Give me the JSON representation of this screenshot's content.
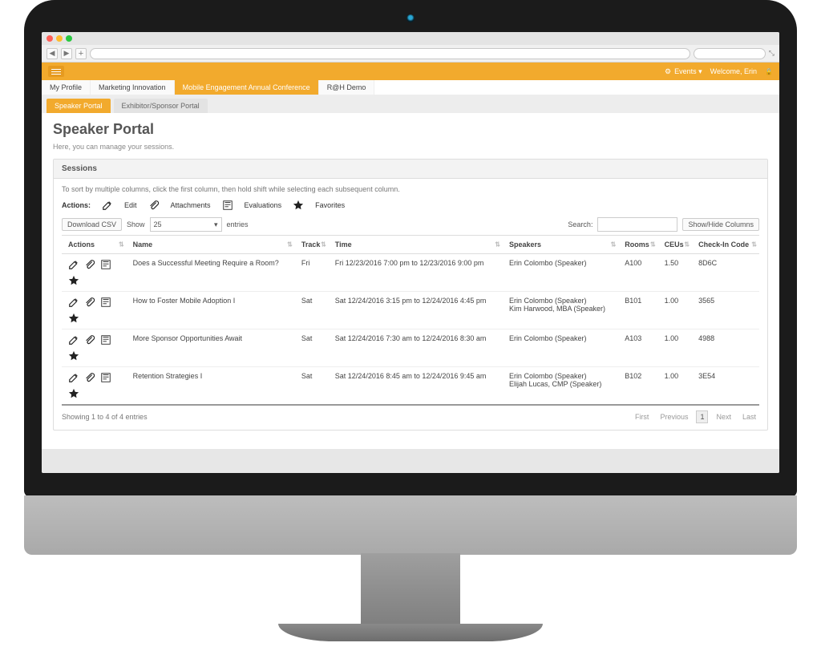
{
  "header": {
    "events_label": "Events",
    "welcome_label": "Welcome, Erin"
  },
  "top_tabs": [
    {
      "label": "My Profile",
      "active": false
    },
    {
      "label": "Marketing Innovation",
      "active": false
    },
    {
      "label": "Mobile Engagement Annual Conference",
      "active": true
    },
    {
      "label": "R@H Demo",
      "active": false
    }
  ],
  "sub_tabs": [
    {
      "label": "Speaker Portal",
      "active": true
    },
    {
      "label": "Exhibitor/Sponsor Portal",
      "active": false
    }
  ],
  "page_title": "Speaker Portal",
  "page_sub": "Here, you can manage your sessions.",
  "panel_title": "Sessions",
  "sort_hint": "To sort by multiple columns, click the first column, then hold shift while selecting each subsequent column.",
  "legend": {
    "label": "Actions:",
    "edit": "Edit",
    "attachments": "Attachments",
    "evaluations": "Evaluations",
    "favorites": "Favorites"
  },
  "controls": {
    "download_csv": "Download CSV",
    "show_label": "Show",
    "show_value": "25",
    "entries_label": "entries",
    "search_label": "Search:",
    "show_hide_cols": "Show/Hide Columns"
  },
  "columns": [
    "Actions",
    "Name",
    "Track",
    "Time",
    "Speakers",
    "Rooms",
    "CEUs",
    "Check-In Code"
  ],
  "rows": [
    {
      "name": "Does a Successful Meeting Require a Room?",
      "track": "Fri",
      "time": "Fri 12/23/2016 7:00 pm to 12/23/2016 9:00 pm",
      "speakers": "Erin Colombo (Speaker)",
      "rooms": "A100",
      "ceus": "1.50",
      "code": "8D6C"
    },
    {
      "name": "How to Foster Mobile Adoption I",
      "track": "Sat",
      "time": "Sat 12/24/2016 3:15 pm to 12/24/2016 4:45 pm",
      "speakers": "Erin Colombo (Speaker)\nKim Harwood, MBA (Speaker)",
      "rooms": "B101",
      "ceus": "1.00",
      "code": "3565"
    },
    {
      "name": "More Sponsor Opportunities Await",
      "track": "Sat",
      "time": "Sat 12/24/2016 7:30 am to 12/24/2016 8:30 am",
      "speakers": "Erin Colombo (Speaker)",
      "rooms": "A103",
      "ceus": "1.00",
      "code": "4988"
    },
    {
      "name": "Retention Strategies I",
      "track": "Sat",
      "time": "Sat 12/24/2016 8:45 am to 12/24/2016 9:45 am",
      "speakers": "Erin Colombo (Speaker)\nElijah Lucas, CMP (Speaker)",
      "rooms": "B102",
      "ceus": "1.00",
      "code": "3E54"
    }
  ],
  "footer": {
    "info": "Showing 1 to 4 of 4 entries",
    "first": "First",
    "prev": "Previous",
    "page": "1",
    "next": "Next",
    "last": "Last"
  }
}
